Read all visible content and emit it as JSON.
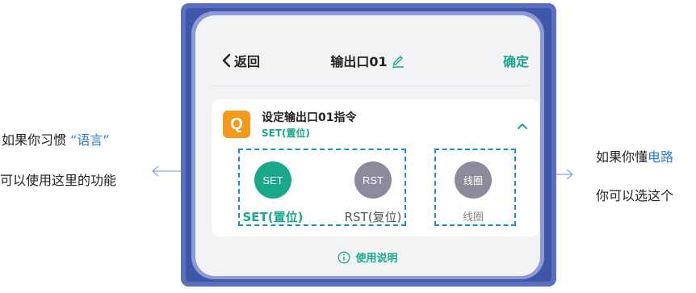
{
  "annotations": {
    "left_line1_prefix": "如果你习惯 ",
    "left_line1_highlight": "“语言”",
    "left_line2": "可以使用这里的功能",
    "right_line1_prefix": "如果你懂",
    "right_line1_highlight": "电路",
    "right_line2": "你可以选这个"
  },
  "header": {
    "back_label": "返回",
    "title": "输出口01",
    "confirm_label": "确定"
  },
  "card": {
    "icon_letter": "Q",
    "title": "设定输出口01指令",
    "subtitle": "SET(置位)",
    "options": [
      {
        "circle": "SET",
        "label": "SET(置位)",
        "selected": true
      },
      {
        "circle": "RST",
        "label": "RST(复位)",
        "selected": false
      },
      {
        "circle": "线圈",
        "label": "线圈",
        "selected": false
      }
    ]
  },
  "help": {
    "label": "使用说明"
  },
  "colors": {
    "accent": "#1aa88a",
    "orange": "#f39a1b",
    "dash_blue": "#1b8fc7",
    "device_blue": "#3f57a8",
    "inactive_circle": "#8b8b9c",
    "highlight_text": "#2b7de0"
  }
}
